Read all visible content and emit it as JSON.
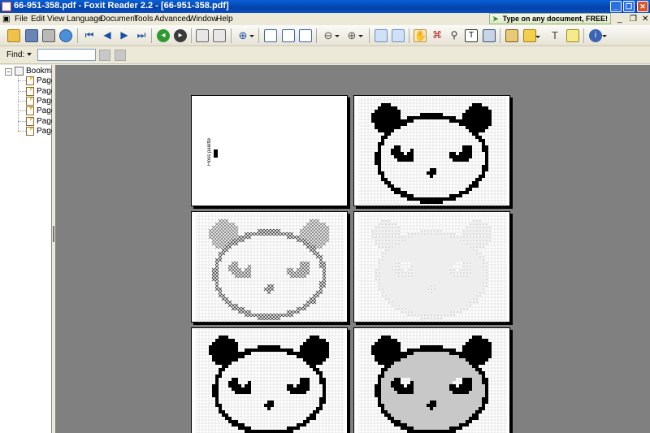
{
  "window": {
    "title": "66-951-358.pdf - Foxit Reader 2.2 - [66-951-358.pdf]"
  },
  "menu": [
    "File",
    "Edit",
    "View",
    "Language",
    "Document",
    "Tools",
    "Advanced",
    "Window",
    "Help"
  ],
  "promo": {
    "text": "Type on any document, FREE!"
  },
  "toolbar": {
    "icons": [
      "open-icon",
      "save-icon",
      "print-icon",
      "email-icon",
      "first-page-icon",
      "previous-page-icon",
      "next-page-icon",
      "last-page-icon",
      "go-back-icon",
      "go-forward-icon",
      "zoom-in-icon",
      "single-page-icon",
      "continuous-page-icon",
      "facing-page-icon",
      "rotate-left-icon",
      "rotate-right-icon",
      "bookmark-panel-icon",
      "thumbnail-panel-icon",
      "hand-tool-icon",
      "select-text-icon",
      "find-icon",
      "typewriter-icon",
      "snapshot-icon",
      "highlight-icon",
      "note-icon",
      "text-tool-icon",
      "comment-icon",
      "info-icon"
    ]
  },
  "find": {
    "label": "Find:",
    "value": ""
  },
  "sidebar": {
    "root": "Bookma",
    "items": [
      "Page",
      "Page",
      "Page",
      "Page",
      "Page",
      "Page"
    ]
  },
  "document": {
    "palette_label": "Floss palette",
    "pages": [
      "cover",
      "panda-bold",
      "panda-cross-outline",
      "panda-faint-dots",
      "panda-bold-2",
      "panda-gray-shaded"
    ]
  }
}
